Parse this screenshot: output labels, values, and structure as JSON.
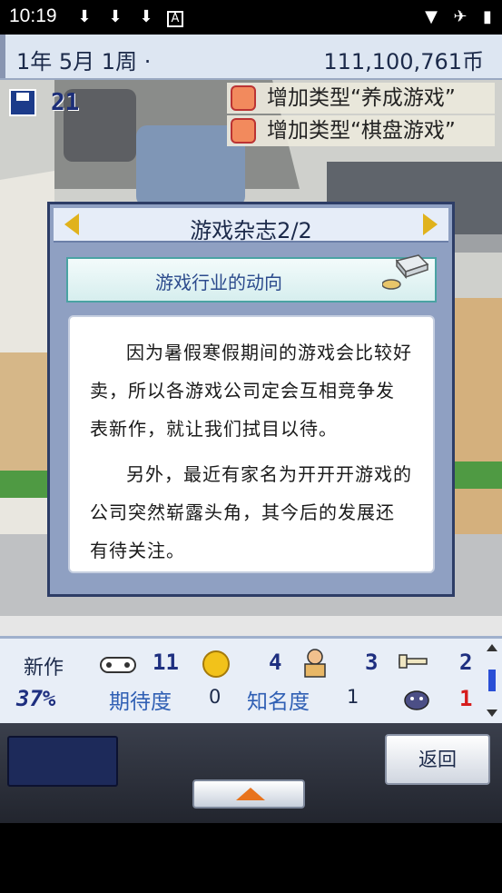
{
  "status_bar": {
    "time": "10:19",
    "icons": [
      "download-icon",
      "download-icon",
      "download-icon",
      "font-icon",
      "wifi-icon",
      "airplane-icon",
      "battery-icon"
    ]
  },
  "top_bar": {
    "date": "1年 5月 1周 ·",
    "money": "111,100,761币"
  },
  "hud": {
    "save_count": "21"
  },
  "notifications": [
    "增加类型“养成游戏”",
    "增加类型“棋盘游戏”"
  ],
  "dialog": {
    "title": "游戏杂志2/2",
    "section_title": "游戏行业的动向",
    "paragraphs": [
      "因为暑假寒假期间的游戏会比较好卖，所以各游戏公司定会互相竞争发表新作，就让我们拭目以待。",
      "另外，最近有家名为开开开游戏的公司突然崭露头角，其今后的发展还有待关注。"
    ]
  },
  "stats": {
    "new_label": "新作",
    "new_percent": "37%",
    "games_count": "11",
    "coins_count": "4",
    "staff_count": "3",
    "keys_count": "2",
    "expectation_label": "期待度",
    "expectation_value": "0",
    "fame_label": "知名度",
    "fame_value": "1",
    "monster_count": "1"
  },
  "buttons": {
    "back": "返回"
  },
  "colors": {
    "accent_blue": "#2f5fb4",
    "dialog_frame": "#2d3d66",
    "arrow_yellow": "#e0b21c",
    "red": "#d61c1c"
  }
}
